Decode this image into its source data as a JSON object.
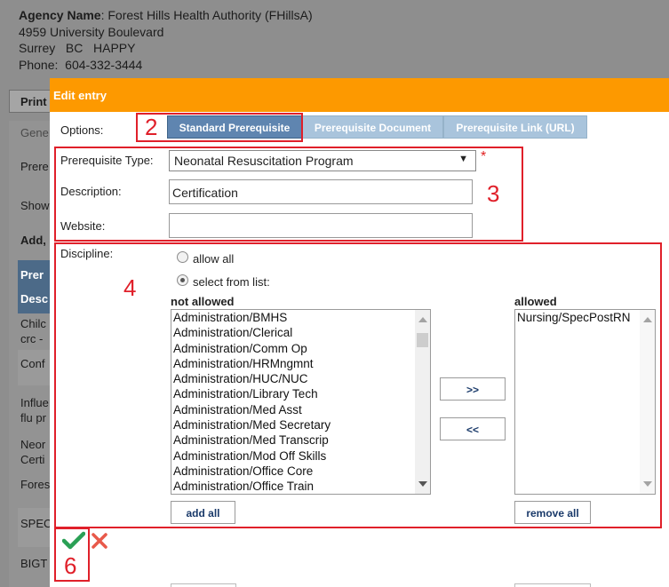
{
  "agency": {
    "name_label": "Agency Name",
    "name_value": ": Forest Hills Health Authority (FHillsA)",
    "address": "4959 University Boulevard",
    "city_line": "Surrey   BC   HAPPY",
    "phone": "Phone:  604-332-3444"
  },
  "background": {
    "print_label": "Print",
    "side_texts": [
      "Gene",
      "Prere",
      "Show",
      "Add,",
      "Prer",
      "Desc",
      "Chilc",
      "crc -",
      "Conf",
      "Influe",
      "flu pr",
      "Neor",
      "Certi",
      "Fores",
      "SPEC",
      "BIGT"
    ]
  },
  "modal": {
    "title": "Edit entry",
    "options_label": "Options:",
    "tabs": [
      "Standard Prerequisite",
      "Prerequisite Document",
      "Prerequisite Link (URL)"
    ],
    "prereq_type_label": "Prerequisite Type:",
    "prereq_type_value": "Neonatal Resuscitation Program",
    "required_mark": "*",
    "description_label": "Description:",
    "description_value": "Certification",
    "website_label": "Website:",
    "website_value": "",
    "discipline_label": "Discipline:",
    "allow_all_label": "allow all",
    "select_from_list_label": "select from list:",
    "not_allowed_header": "not allowed",
    "allowed_header": "allowed",
    "not_allowed_items": [
      "Administration/BMHS",
      "Administration/Clerical",
      "Administration/Comm Op",
      "Administration/HRMngmnt",
      "Administration/HUC/NUC",
      "Administration/Library Tech",
      "Administration/Med Asst",
      "Administration/Med Secretary",
      "Administration/Med Transcrip",
      "Administration/Mod Off Skills",
      "Administration/Office Core",
      "Administration/Office Train"
    ],
    "allowed_items": [
      "Nursing/SpecPostRN"
    ],
    "move_right_label": ">>",
    "move_left_label": "<<",
    "add_all_label": "add all",
    "remove_all_label": "remove all"
  },
  "annotations": {
    "tabs_number": "2",
    "fields_number": "3",
    "discipline_number": "4",
    "save_number": "6"
  },
  "colors": {
    "header": "#fd9900",
    "annotation": "#e0202a",
    "save_check": "#2aa055",
    "cancel_x": "#e8594a"
  }
}
